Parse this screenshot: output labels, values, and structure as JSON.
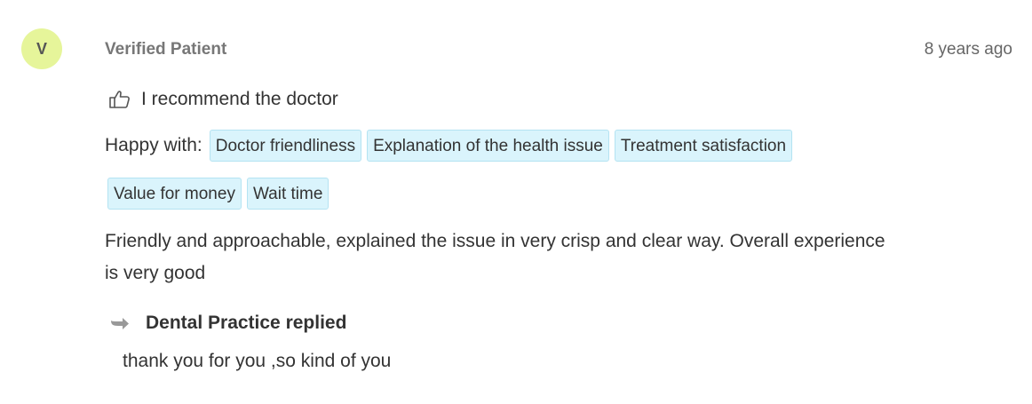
{
  "review": {
    "avatar_initial": "V",
    "author": "Verified Patient",
    "time": "8 years ago",
    "recommend_text": "I recommend the doctor",
    "recommend_icon": "thumbs-up-icon",
    "happy_label": "Happy with:",
    "tags": [
      "Doctor friendliness",
      "Explanation of the health issue",
      "Treatment satisfaction",
      "Value for money",
      "Wait time"
    ],
    "comment": "Friendly and approachable, explained the issue in very crisp and clear way. Overall experience is very good"
  },
  "reply": {
    "icon": "reply-arrow-icon",
    "title": "Dental Practice replied",
    "text": "thank you for you ,so kind of you"
  },
  "colors": {
    "avatar_bg": "#e6f59a",
    "tag_bg": "#daf4fc",
    "tag_border": "#b4e3f2",
    "text": "#333333",
    "muted": "#777777"
  }
}
